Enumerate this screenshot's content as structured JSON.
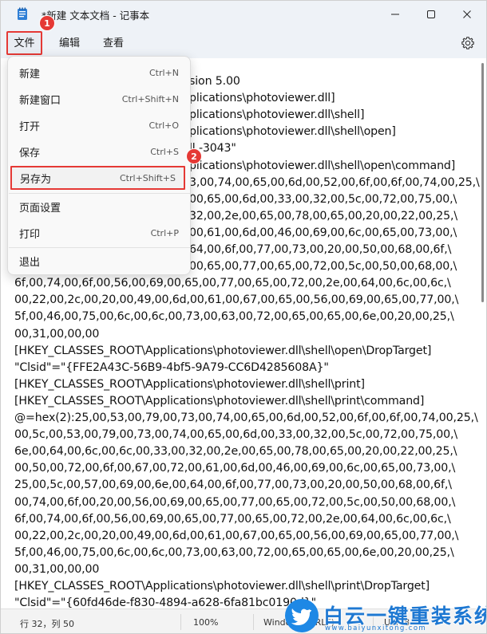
{
  "window": {
    "title": "*新建 文本文档 - 记事本"
  },
  "menubar": {
    "file": "文件",
    "edit": "编辑",
    "view": "查看"
  },
  "icons": {
    "app": "notepad-icon",
    "minimize": "minimize-icon",
    "maximize": "maximize-icon",
    "close": "close-icon",
    "settings": "gear-icon"
  },
  "file_menu": {
    "items": [
      {
        "label": "新建",
        "shortcut": "Ctrl+N"
      },
      {
        "label": "新建窗口",
        "shortcut": "Ctrl+Shift+N"
      },
      {
        "label": "打开",
        "shortcut": "Ctrl+O"
      },
      {
        "label": "保存",
        "shortcut": "Ctrl+S"
      },
      {
        "label": "另存为",
        "shortcut": "Ctrl+Shift+S"
      },
      {
        "label": "页面设置",
        "shortcut": ""
      },
      {
        "label": "打印",
        "shortcut": "Ctrl+P"
      },
      {
        "label": "退出",
        "shortcut": ""
      }
    ]
  },
  "badges": {
    "step1": "1",
    "step2": "2"
  },
  "editor": {
    "lines": [
      "sion 5.00",
      "plications\\photoviewer.dll]",
      "plications\\photoviewer.dll\\shell]",
      "plications\\photoviewer.dll\\shell\\open]",
      "ll,-3043\"",
      "plications\\photoviewer.dll\\shell\\open\\command]",
      "3,00,74,00,65,00,6d,00,52,00,6f,00,6f,00,74,00,25,\\",
      "00,65,00,6d,00,33,00,32,00,5c,00,72,00,75,00,\\",
      "32,00,2e,00,65,00,78,00,65,00,20,00,22,00,25,\\",
      "00,61,00,6d,00,46,00,69,00,6c,00,65,00,73,00,\\",
      "64,00,6f,00,77,00,73,00,20,00,50,00,68,00,6f,\\",
      "00,65,00,77,00,65,00,72,00,5c,00,50,00,68,00,\\",
      "6f,00,74,00,6f,00,56,00,69,00,65,00,77,00,65,00,72,00,2e,00,64,00,6c,00,6c,\\",
      "00,22,00,2c,00,20,00,49,00,6d,00,61,00,67,00,65,00,56,00,69,00,65,00,77,00,\\",
      "5f,00,46,00,75,00,6c,00,6c,00,73,00,63,00,72,00,65,00,65,00,6e,00,20,00,25,\\",
      "00,31,00,00,00",
      "[HKEY_CLASSES_ROOT\\Applications\\photoviewer.dll\\shell\\open\\DropTarget]",
      "\"Clsid\"=\"{FFE2A43C-56B9-4bf5-9A79-CC6D4285608A}\"",
      "[HKEY_CLASSES_ROOT\\Applications\\photoviewer.dll\\shell\\print]",
      "[HKEY_CLASSES_ROOT\\Applications\\photoviewer.dll\\shell\\print\\command]",
      "@=hex(2):25,00,53,00,79,00,73,00,74,00,65,00,6d,00,52,00,6f,00,6f,00,74,00,25,\\",
      "00,5c,00,53,00,79,00,73,00,74,00,65,00,6d,00,33,00,32,00,5c,00,72,00,75,00,\\",
      "6e,00,64,00,6c,00,6c,00,33,00,32,00,2e,00,65,00,78,00,65,00,20,00,22,00,25,\\",
      "00,50,00,72,00,6f,00,67,00,72,00,61,00,6d,00,46,00,69,00,6c,00,65,00,73,00,\\",
      "25,00,5c,00,57,00,69,00,6e,00,64,00,6f,00,77,00,73,00,20,00,50,00,68,00,6f,\\",
      "00,74,00,6f,00,20,00,56,00,69,00,65,00,77,00,65,00,72,00,5c,00,50,00,68,00,\\",
      "6f,00,74,00,6f,00,56,00,69,00,65,00,77,00,65,00,72,00,2e,00,64,00,6c,00,6c,\\",
      "00,22,00,2c,00,20,00,49,00,6d,00,61,00,67,00,65,00,56,00,69,00,65,00,77,00,\\",
      "5f,00,46,00,75,00,6c,00,6c,00,73,00,63,00,72,00,65,00,65,00,6e,00,20,00,25,\\",
      "00,31,00,00,00",
      "[HKEY_CLASSES_ROOT\\Applications\\photoviewer.dll\\shell\\print\\DropTarget]",
      "\"Clsid\"=\"{60fd46de-f830-4894-a628-6fa81bc0190d}\""
    ]
  },
  "statusbar": {
    "position": "行 32，列 50",
    "zoom": "100%",
    "line_ending": "Windows (CRLF)",
    "encoding": "UTF-8"
  },
  "watermark": {
    "name": "白云一键重装系统",
    "url": "www.baiyunxitong.com"
  },
  "colors": {
    "highlight": "#e53935",
    "titlebar": "#eef2f7",
    "brand_blue": "#1e88e5"
  }
}
